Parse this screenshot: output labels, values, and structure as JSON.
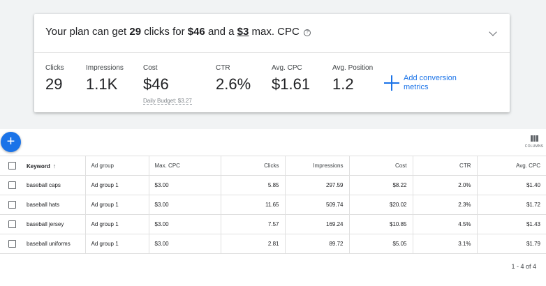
{
  "summary": {
    "plan_prefix": "Your plan can get ",
    "clicks_bold": "29",
    "mid1": " clicks for ",
    "cost_bold": "$46",
    "mid2": " and a ",
    "cpc_bold": "$3",
    "suffix": " max. CPC",
    "help_glyph": "?",
    "metrics": [
      {
        "label": "Clicks",
        "value": "29"
      },
      {
        "label": "Impressions",
        "value": "1.1K"
      },
      {
        "label": "Cost",
        "value": "$46",
        "sub": "Daily Budget: $3.27"
      },
      {
        "label": "CTR",
        "value": "2.6%"
      },
      {
        "label": "Avg. CPC",
        "value": "$1.61"
      },
      {
        "label": "Avg. Position",
        "value": "1.2"
      }
    ],
    "add_conversion_label": "Add conversion metrics"
  },
  "toolbar": {
    "fab_glyph": "+",
    "columns_label": "COLUMNS"
  },
  "table": {
    "headers": [
      "Keyword",
      "Ad group",
      "Max. CPC",
      "Clicks",
      "Impressions",
      "Cost",
      "CTR",
      "Avg. CPC"
    ],
    "sort_glyph": "↑",
    "rows": [
      [
        "baseball caps",
        "Ad group 1",
        "$3.00",
        "5.85",
        "297.59",
        "$8.22",
        "2.0%",
        "$1.40"
      ],
      [
        "baseball hats",
        "Ad group 1",
        "$3.00",
        "11.65",
        "509.74",
        "$20.02",
        "2.3%",
        "$1.72"
      ],
      [
        "baseball jersey",
        "Ad group 1",
        "$3.00",
        "7.57",
        "169.24",
        "$10.85",
        "4.5%",
        "$1.43"
      ],
      [
        "baseball uniforms",
        "Ad group 1",
        "$3.00",
        "2.81",
        "89.72",
        "$5.05",
        "3.1%",
        "$1.79"
      ]
    ]
  },
  "pager": {
    "text": "1 - 4 of 4"
  },
  "colors": {
    "accent": "#1a73e8",
    "band": "#f1f3f4"
  }
}
